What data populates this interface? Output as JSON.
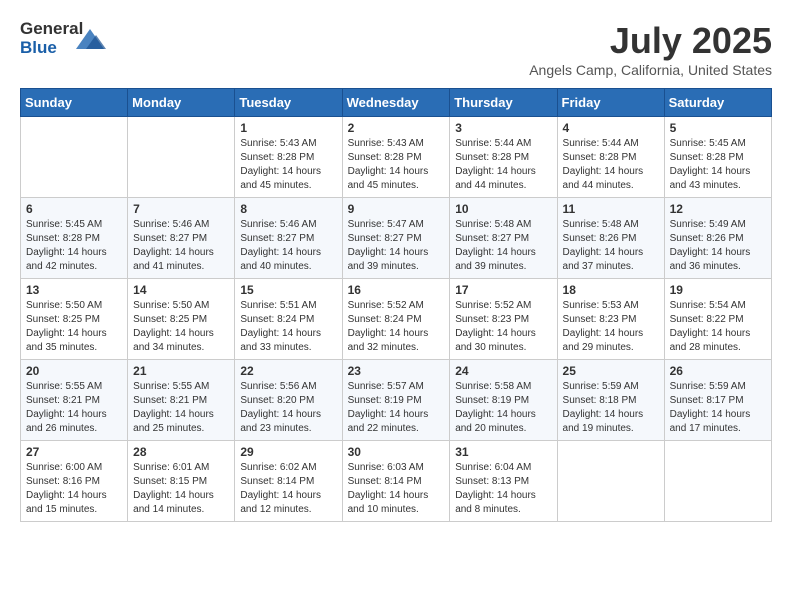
{
  "header": {
    "logo_general": "General",
    "logo_blue": "Blue",
    "title": "July 2025",
    "location": "Angels Camp, California, United States"
  },
  "weekdays": [
    "Sunday",
    "Monday",
    "Tuesday",
    "Wednesday",
    "Thursday",
    "Friday",
    "Saturday"
  ],
  "weeks": [
    [
      {
        "day": "",
        "info": ""
      },
      {
        "day": "",
        "info": ""
      },
      {
        "day": "1",
        "info": "Sunrise: 5:43 AM\nSunset: 8:28 PM\nDaylight: 14 hours and 45 minutes."
      },
      {
        "day": "2",
        "info": "Sunrise: 5:43 AM\nSunset: 8:28 PM\nDaylight: 14 hours and 45 minutes."
      },
      {
        "day": "3",
        "info": "Sunrise: 5:44 AM\nSunset: 8:28 PM\nDaylight: 14 hours and 44 minutes."
      },
      {
        "day": "4",
        "info": "Sunrise: 5:44 AM\nSunset: 8:28 PM\nDaylight: 14 hours and 44 minutes."
      },
      {
        "day": "5",
        "info": "Sunrise: 5:45 AM\nSunset: 8:28 PM\nDaylight: 14 hours and 43 minutes."
      }
    ],
    [
      {
        "day": "6",
        "info": "Sunrise: 5:45 AM\nSunset: 8:28 PM\nDaylight: 14 hours and 42 minutes."
      },
      {
        "day": "7",
        "info": "Sunrise: 5:46 AM\nSunset: 8:27 PM\nDaylight: 14 hours and 41 minutes."
      },
      {
        "day": "8",
        "info": "Sunrise: 5:46 AM\nSunset: 8:27 PM\nDaylight: 14 hours and 40 minutes."
      },
      {
        "day": "9",
        "info": "Sunrise: 5:47 AM\nSunset: 8:27 PM\nDaylight: 14 hours and 39 minutes."
      },
      {
        "day": "10",
        "info": "Sunrise: 5:48 AM\nSunset: 8:27 PM\nDaylight: 14 hours and 39 minutes."
      },
      {
        "day": "11",
        "info": "Sunrise: 5:48 AM\nSunset: 8:26 PM\nDaylight: 14 hours and 37 minutes."
      },
      {
        "day": "12",
        "info": "Sunrise: 5:49 AM\nSunset: 8:26 PM\nDaylight: 14 hours and 36 minutes."
      }
    ],
    [
      {
        "day": "13",
        "info": "Sunrise: 5:50 AM\nSunset: 8:25 PM\nDaylight: 14 hours and 35 minutes."
      },
      {
        "day": "14",
        "info": "Sunrise: 5:50 AM\nSunset: 8:25 PM\nDaylight: 14 hours and 34 minutes."
      },
      {
        "day": "15",
        "info": "Sunrise: 5:51 AM\nSunset: 8:24 PM\nDaylight: 14 hours and 33 minutes."
      },
      {
        "day": "16",
        "info": "Sunrise: 5:52 AM\nSunset: 8:24 PM\nDaylight: 14 hours and 32 minutes."
      },
      {
        "day": "17",
        "info": "Sunrise: 5:52 AM\nSunset: 8:23 PM\nDaylight: 14 hours and 30 minutes."
      },
      {
        "day": "18",
        "info": "Sunrise: 5:53 AM\nSunset: 8:23 PM\nDaylight: 14 hours and 29 minutes."
      },
      {
        "day": "19",
        "info": "Sunrise: 5:54 AM\nSunset: 8:22 PM\nDaylight: 14 hours and 28 minutes."
      }
    ],
    [
      {
        "day": "20",
        "info": "Sunrise: 5:55 AM\nSunset: 8:21 PM\nDaylight: 14 hours and 26 minutes."
      },
      {
        "day": "21",
        "info": "Sunrise: 5:55 AM\nSunset: 8:21 PM\nDaylight: 14 hours and 25 minutes."
      },
      {
        "day": "22",
        "info": "Sunrise: 5:56 AM\nSunset: 8:20 PM\nDaylight: 14 hours and 23 minutes."
      },
      {
        "day": "23",
        "info": "Sunrise: 5:57 AM\nSunset: 8:19 PM\nDaylight: 14 hours and 22 minutes."
      },
      {
        "day": "24",
        "info": "Sunrise: 5:58 AM\nSunset: 8:19 PM\nDaylight: 14 hours and 20 minutes."
      },
      {
        "day": "25",
        "info": "Sunrise: 5:59 AM\nSunset: 8:18 PM\nDaylight: 14 hours and 19 minutes."
      },
      {
        "day": "26",
        "info": "Sunrise: 5:59 AM\nSunset: 8:17 PM\nDaylight: 14 hours and 17 minutes."
      }
    ],
    [
      {
        "day": "27",
        "info": "Sunrise: 6:00 AM\nSunset: 8:16 PM\nDaylight: 14 hours and 15 minutes."
      },
      {
        "day": "28",
        "info": "Sunrise: 6:01 AM\nSunset: 8:15 PM\nDaylight: 14 hours and 14 minutes."
      },
      {
        "day": "29",
        "info": "Sunrise: 6:02 AM\nSunset: 8:14 PM\nDaylight: 14 hours and 12 minutes."
      },
      {
        "day": "30",
        "info": "Sunrise: 6:03 AM\nSunset: 8:14 PM\nDaylight: 14 hours and 10 minutes."
      },
      {
        "day": "31",
        "info": "Sunrise: 6:04 AM\nSunset: 8:13 PM\nDaylight: 14 hours and 8 minutes."
      },
      {
        "day": "",
        "info": ""
      },
      {
        "day": "",
        "info": ""
      }
    ]
  ]
}
